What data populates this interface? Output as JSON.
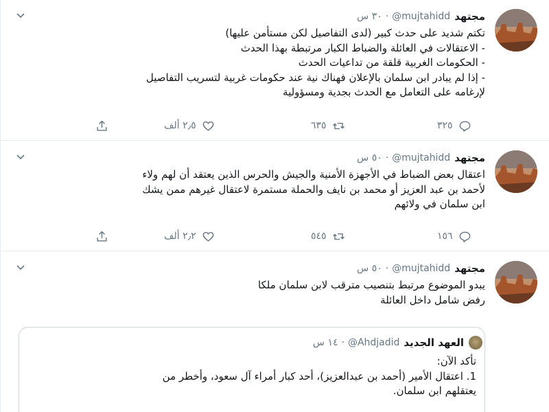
{
  "tweets": [
    {
      "name": "مجتهد",
      "handle": "@mujtahidd",
      "time": "٣٠ س",
      "lines": [
        "تكتم شديد على حدث كبير  (لدى التفاصيل لكن مستأمن عليها)",
        "- الاعتقالات في العائلة والضباط الكبار مرتبطة بهذا الحدث",
        "- الحكومات الغربية قلقة من تداعيات الحدث",
        "- إذا لم يبادر ابن سلمان بالإعلان فهناك نية عند حكومات غربية لتسريب التفاصيل",
        "لإرغامه على التعامل مع الحدث بجدية ومسؤولية"
      ],
      "replies": "٣٢٥",
      "retweets": "٦٣٥",
      "likes": "٢٫٥ ألف"
    },
    {
      "name": "مجتهد",
      "handle": "@mujtahidd",
      "time": "٥٠ س",
      "lines": [
        "اعتقال بعض الضباط في الأجهزة الأمنية والجيش والحرس الذين يعتقد أن لهم ولاء",
        "لأحمد بن عبد العزيز أو محمد بن نايف والحملة مستمرة لاعتقال غيرهم ممن يشك",
        "ابن سلمان في ولائهم"
      ],
      "replies": "١٥٦",
      "retweets": "٥٤٥",
      "likes": "٢٫٢ ألف"
    },
    {
      "name": "مجتهد",
      "handle": "@mujtahidd",
      "time": "٥٠ س",
      "lines": [
        "يبدو الموضوع مرتبط بتنصيب مترقب لابن سلمان ملكا",
        "رفض شامل داخل العائلة"
      ],
      "quote": {
        "name": "العهد الجديد",
        "handle": "@Ahdjadid",
        "time": "١٤ س",
        "lines": [
          "تأكد الآن:",
          "1. اعتقال الأمير (أحمد بن عبدالعزيز)، أحد كبار أمراء آل سعود، وأخطر من",
          "يعتقلهم ابن سلمان."
        ]
      }
    }
  ],
  "ui": {
    "dot": "·",
    "icons": [
      "reply-icon",
      "retweet-icon",
      "like-icon",
      "share-icon",
      "chevron-down-icon"
    ],
    "colors": {
      "text": "#14171a",
      "secondary": "#657786",
      "border": "#e6ecf0"
    }
  }
}
